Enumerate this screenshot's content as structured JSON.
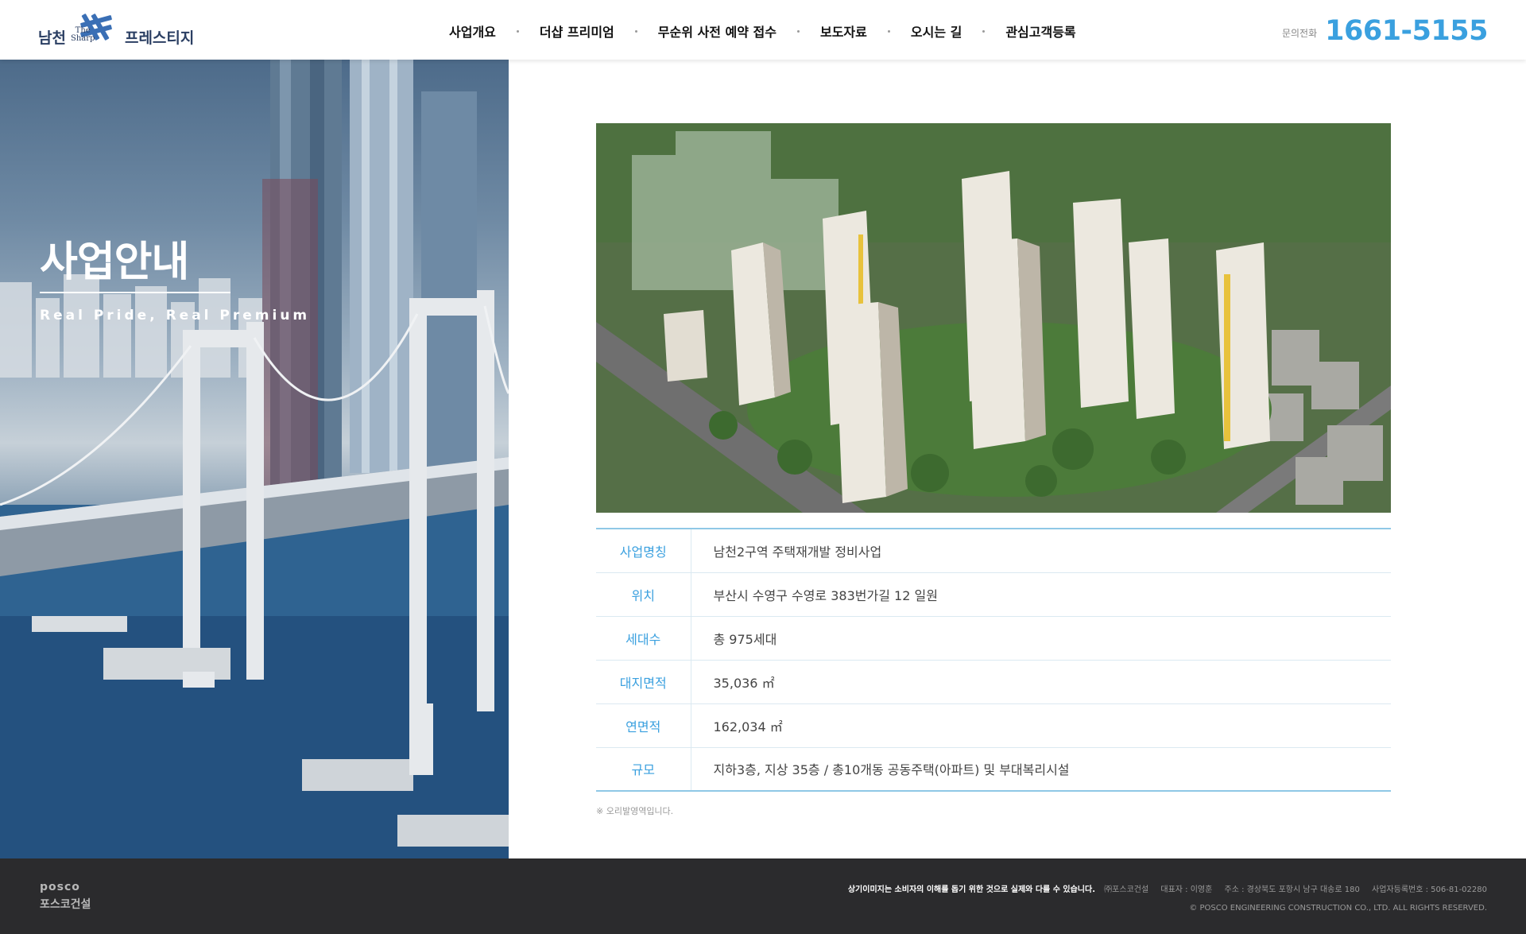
{
  "header": {
    "logo": {
      "left": "남천",
      "mark_the": "The",
      "mark_sharp": "Sharp",
      "right": "프레스티지"
    },
    "nav": [
      {
        "label": "사업개요"
      },
      {
        "label": "더샵 프리미엄"
      },
      {
        "label": "무순위 사전 예약 접수"
      },
      {
        "label": "보도자료"
      },
      {
        "label": "오시는 길"
      },
      {
        "label": "관심고객등록"
      }
    ],
    "phone": {
      "label": "문의전화",
      "number": "1661-5155"
    }
  },
  "visual": {
    "title": "사업안내",
    "subtitle": "Real Pride, Real Premium"
  },
  "project_info": {
    "rows": [
      {
        "label": "사업명칭",
        "value": "남천2구역 주택재개발 정비사업"
      },
      {
        "label": "위치",
        "value": "부산시 수영구 수영로 383번가길 12 일원"
      },
      {
        "label": "세대수",
        "value": "총 975세대"
      },
      {
        "label": "대지면적",
        "value": "35,036 ㎡"
      },
      {
        "label": "연면적",
        "value": "162,034 ㎡"
      },
      {
        "label": "규모",
        "value": "지하3층, 지상 35층 / 총10개동  공동주택(아파트) 및 부대복리시설"
      }
    ],
    "disclaimer": "※ 오리발영역입니다."
  },
  "footer": {
    "brand": "posco",
    "brand_kor": "포스코건설",
    "notice": "상기이미지는 소비자의 이해를 돕기 위한 것으로 실제와 다를 수 있습니다.",
    "company": "㈜포스코건설",
    "ceo": "대표자 : 이영훈",
    "address": "주소 : 경상북도 포항시 남구 대송로 180",
    "biz_no": "사업자등록번호 : 506-81-02280",
    "copyright": "© POSCO ENGINEERING CONSTRUCTION CO., LTD. ALL RIGHTS RESERVED."
  },
  "colors": {
    "accent": "#3aa0df",
    "table_border": "#8fc8e6",
    "footer_bg": "#2b2b2d"
  }
}
